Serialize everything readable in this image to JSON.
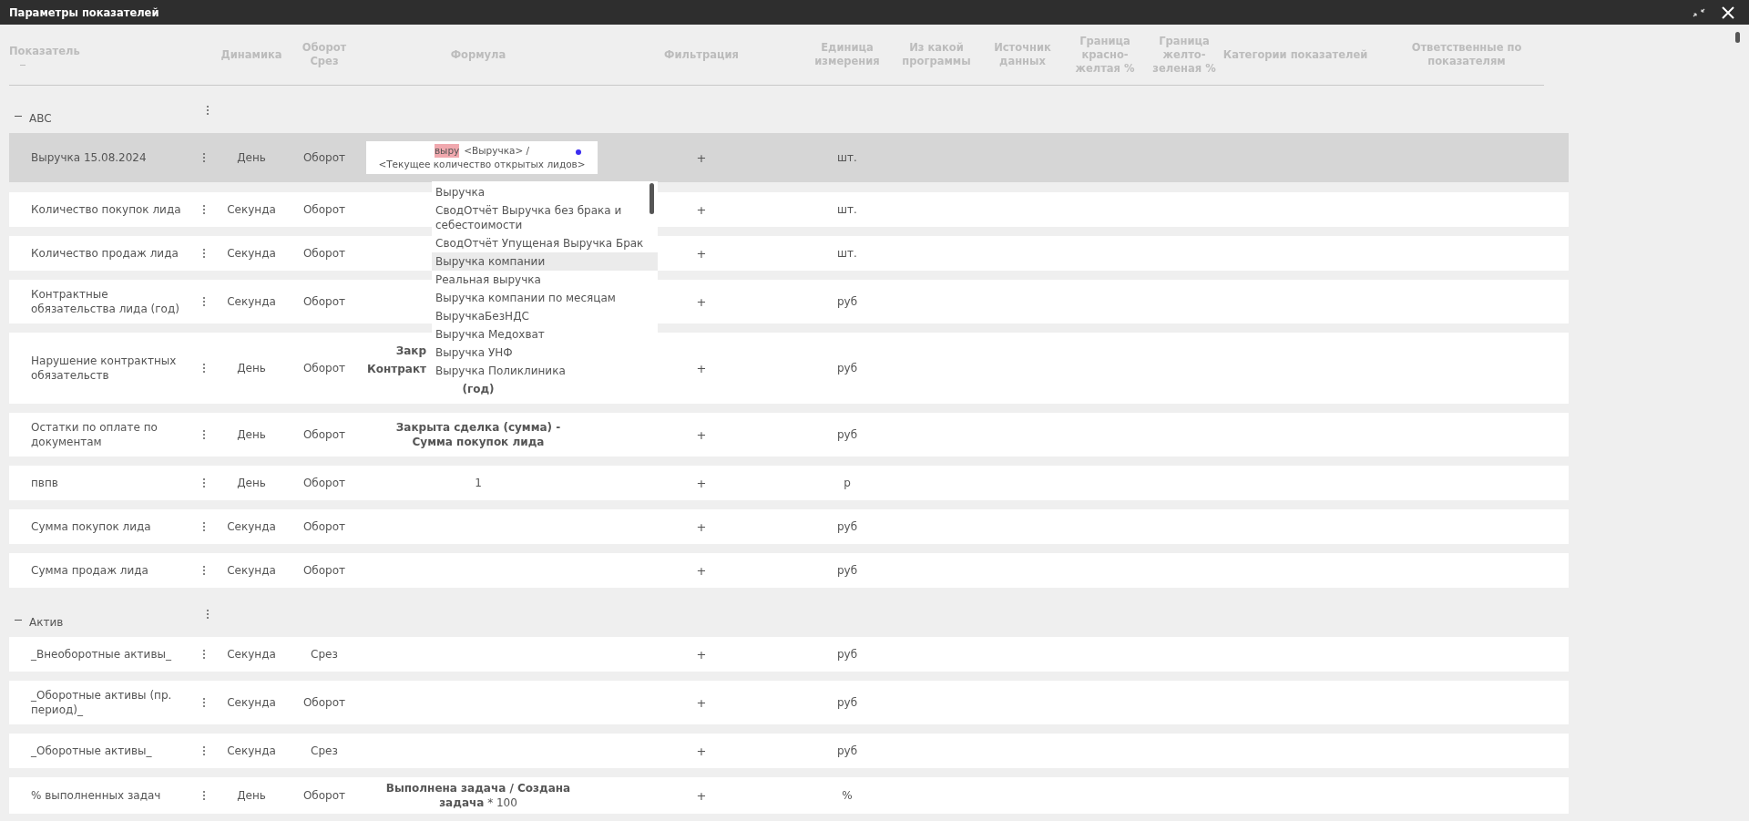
{
  "window": {
    "title": "Параметры показателей"
  },
  "columns": [
    {
      "label": "Показатель"
    },
    {
      "label": "Динамика"
    },
    {
      "label": "Оборот Срез"
    },
    {
      "label": "Формула"
    },
    {
      "label": "Фильтрация"
    },
    {
      "label": "Единица измерения"
    },
    {
      "label": "Из какой программы"
    },
    {
      "label": "Источник данных"
    },
    {
      "label": "Граница красно-желтая %"
    },
    {
      "label": "Граница желто-зеленая %"
    },
    {
      "label": "Категории показателей"
    },
    {
      "label": "Ответственные по показателям"
    }
  ],
  "groups": [
    {
      "name": "ABC",
      "expanded": true,
      "rows": [
        {
          "name": "Выручка 15.08.2024",
          "selected": true,
          "dynamics": "День",
          "turnover": "Оборот",
          "formula_editor": {
            "segments": [
              {
                "text": "выру",
                "highlighted": true
              },
              {
                "text": "<Выручка> /",
                "highlighted": false
              }
            ],
            "line2": "<Текущее количество открытых лидов>"
          },
          "filter": "+",
          "unit": "шт."
        },
        {
          "name": "Количество покупок лида",
          "selected": false,
          "dynamics": "Секунда",
          "turnover": "Оборот",
          "filter": "+",
          "unit": "шт."
        },
        {
          "name": "Количество продаж лида",
          "selected": false,
          "dynamics": "Секунда",
          "turnover": "Оборот",
          "filter": "+",
          "unit": "шт."
        },
        {
          "name": "Контрактные обязательства лида (год)",
          "selected": false,
          "dynamics": "Секунда",
          "turnover": "Оборот",
          "filter": "+",
          "unit": "руб"
        },
        {
          "name": "Нарушение контрактных обязательств",
          "selected": false,
          "dynamics": "День",
          "turnover": "Оборот",
          "formula_lines": [
            "Закр",
            "Контракт",
            "(год)"
          ],
          "filter": "+",
          "unit": "руб"
        },
        {
          "name": "Остатки по оплате по документам",
          "selected": false,
          "dynamics": "День",
          "turnover": "Оборот",
          "formula": "Закрыта сделка (сумма) - Сумма покупок лида",
          "formula_bold": true,
          "filter": "+",
          "unit": "руб"
        },
        {
          "name": "пвпв",
          "selected": false,
          "dynamics": "День",
          "turnover": "Оборот",
          "formula": "1",
          "formula_bold": false,
          "filter": "+",
          "unit": "р"
        },
        {
          "name": "Сумма покупок лида",
          "selected": false,
          "dynamics": "Секунда",
          "turnover": "Оборот",
          "filter": "+",
          "unit": "руб"
        },
        {
          "name": "Сумма продаж лида",
          "selected": false,
          "dynamics": "Секунда",
          "turnover": "Оборот",
          "filter": "+",
          "unit": "руб"
        }
      ]
    },
    {
      "name": "Актив",
      "expanded": true,
      "rows": [
        {
          "name": "_Внеоборотные активы_",
          "selected": false,
          "dynamics": "Секунда",
          "turnover": "Срез",
          "filter": "+",
          "unit": "руб"
        },
        {
          "name": "_Оборотные активы (пр. период)_",
          "selected": false,
          "dynamics": "Секунда",
          "turnover": "Оборот",
          "filter": "+",
          "unit": "руб"
        },
        {
          "name": "_Оборотные активы_",
          "selected": false,
          "dynamics": "Секунда",
          "turnover": "Срез",
          "filter": "+",
          "unit": "руб"
        },
        {
          "name": "% выполненных задач",
          "selected": false,
          "dynamics": "День",
          "turnover": "Оборот",
          "formula": "**Выполнена задача / Создана задача** * 100",
          "formula_bold": false,
          "filter": "+",
          "unit": "%"
        }
      ]
    }
  ],
  "suggestions": [
    {
      "label": "Выручка",
      "selected": false
    },
    {
      "label": "СводОтчёт Выручка без брака и себестоимости",
      "selected": false
    },
    {
      "label": "СводОтчёт Упущеная Выручка Брак",
      "selected": false
    },
    {
      "label": "Выручка компании",
      "selected": true
    },
    {
      "label": "Реальная выручка",
      "selected": false
    },
    {
      "label": "Выручка компании по месяцам",
      "selected": false
    },
    {
      "label": "ВыручкаБезНДС",
      "selected": false
    },
    {
      "label": "Выручка Медохват",
      "selected": false
    },
    {
      "label": "Выручка УНФ",
      "selected": false
    },
    {
      "label": "Выручка Поликлиника",
      "selected": false
    }
  ]
}
